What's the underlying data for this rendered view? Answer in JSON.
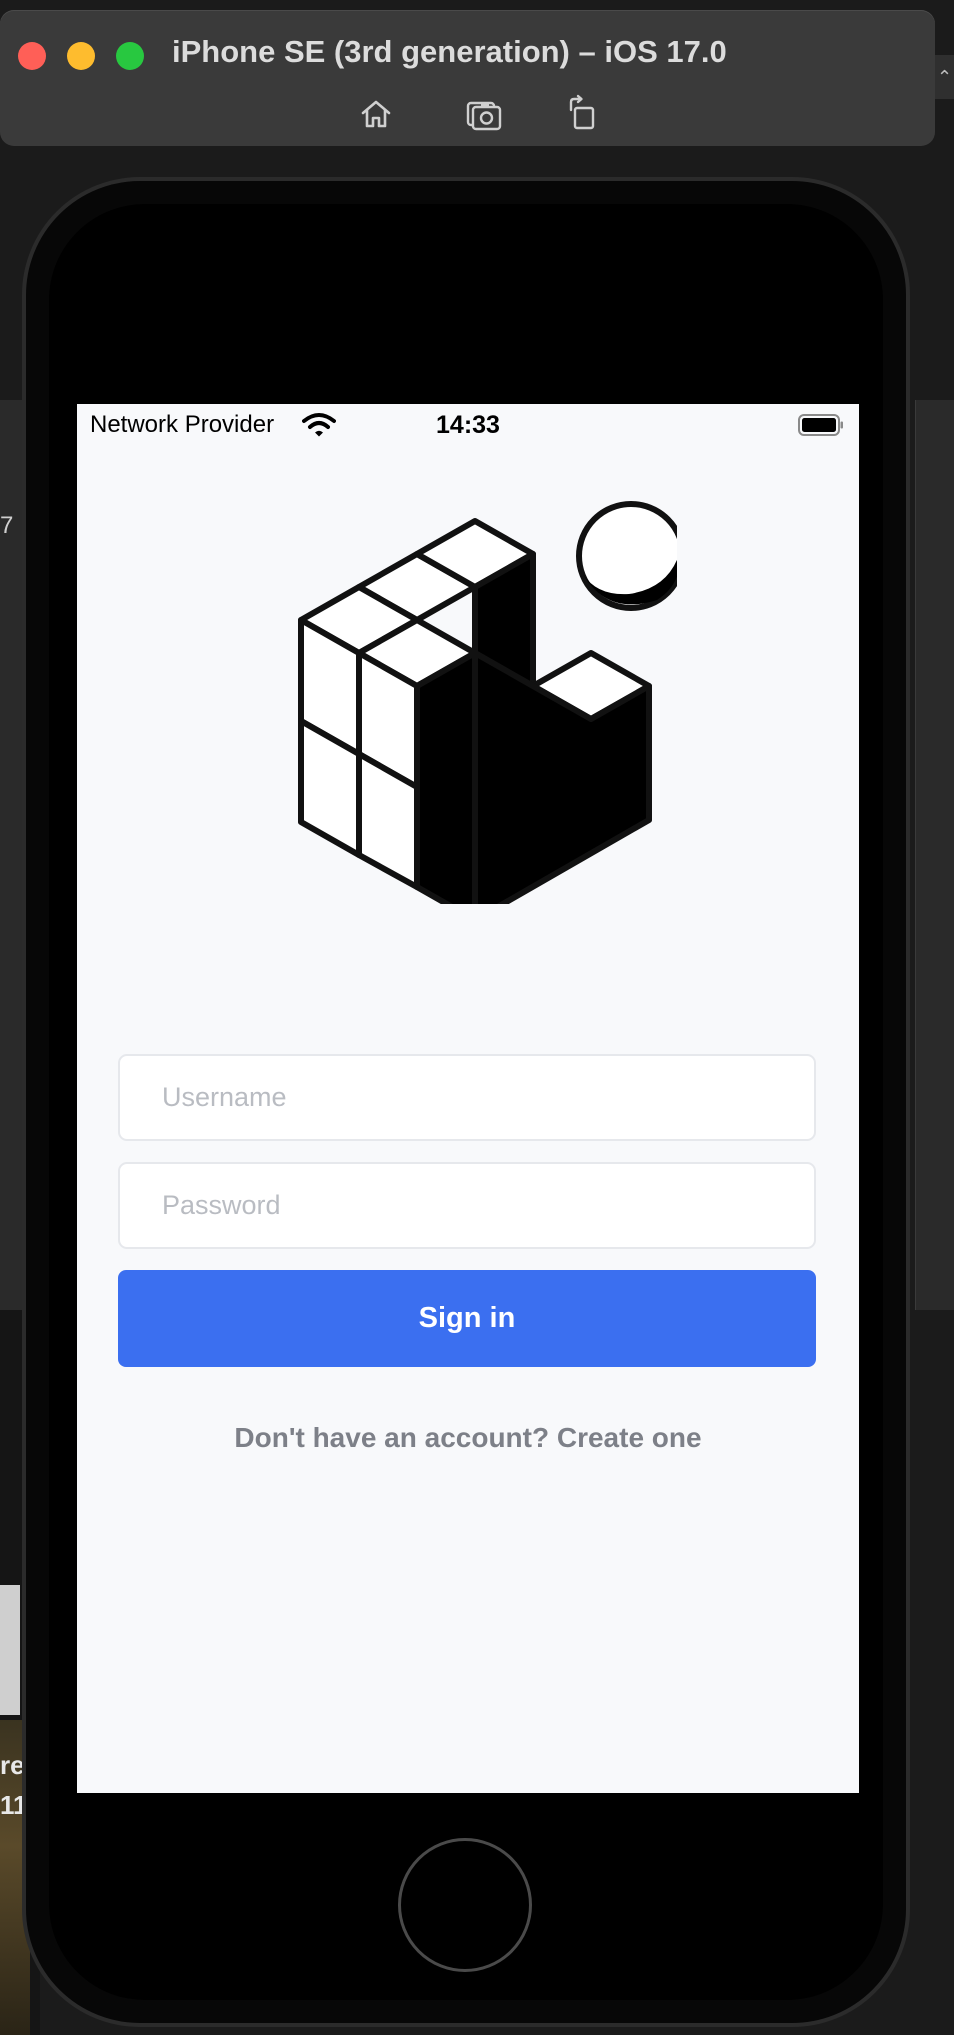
{
  "simulator": {
    "title": "iPhone SE (3rd generation) – iOS 17.0",
    "toolbar": [
      "home-icon",
      "screenshot-icon",
      "rotate-icon"
    ]
  },
  "status_bar": {
    "carrier": "Network Provider",
    "time": "14:33"
  },
  "login": {
    "username_placeholder": "Username",
    "password_placeholder": "Password",
    "username_value": "",
    "password_value": "",
    "signin_label": "Sign in",
    "create_account_label": "Don't have an account? Create one"
  },
  "background": {
    "side_number": "7",
    "side_text_1": "re",
    "side_text_2": "11"
  },
  "colors": {
    "accent": "#3b6ff0",
    "screen_bg": "#f8f9fb",
    "link": "#7d8088"
  }
}
